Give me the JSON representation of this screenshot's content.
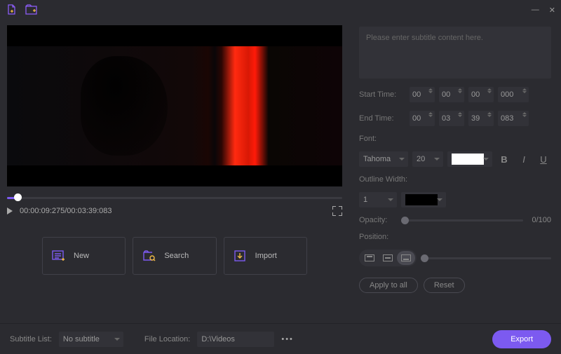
{
  "subtitle": {
    "placeholder": "Please enter subtitle content here."
  },
  "time": {
    "start_label": "Start Time:",
    "end_label": "End Time:",
    "start": {
      "h": "00",
      "m": "00",
      "s": "00",
      "ms": "000"
    },
    "end": {
      "h": "00",
      "m": "03",
      "s": "39",
      "ms": "083"
    }
  },
  "playback": {
    "current": "00:00:09:275",
    "total": "00:03:39:083",
    "sep": "/"
  },
  "actions": {
    "new": "New",
    "search": "Search",
    "import": "Import"
  },
  "font": {
    "label": "Font:",
    "family": "Tahoma",
    "size": "20"
  },
  "outline": {
    "label": "Outline Width:",
    "value": "1"
  },
  "opacity": {
    "label": "Opacity:",
    "readout": "0/100"
  },
  "position": {
    "label": "Position:"
  },
  "buttons": {
    "apply": "Apply to all",
    "reset": "Reset",
    "export": "Export"
  },
  "bottom": {
    "sub_label": "Subtitle List:",
    "sub_value": "No subtitle",
    "loc_label": "File Location:",
    "loc_value": "D:\\Videos"
  }
}
